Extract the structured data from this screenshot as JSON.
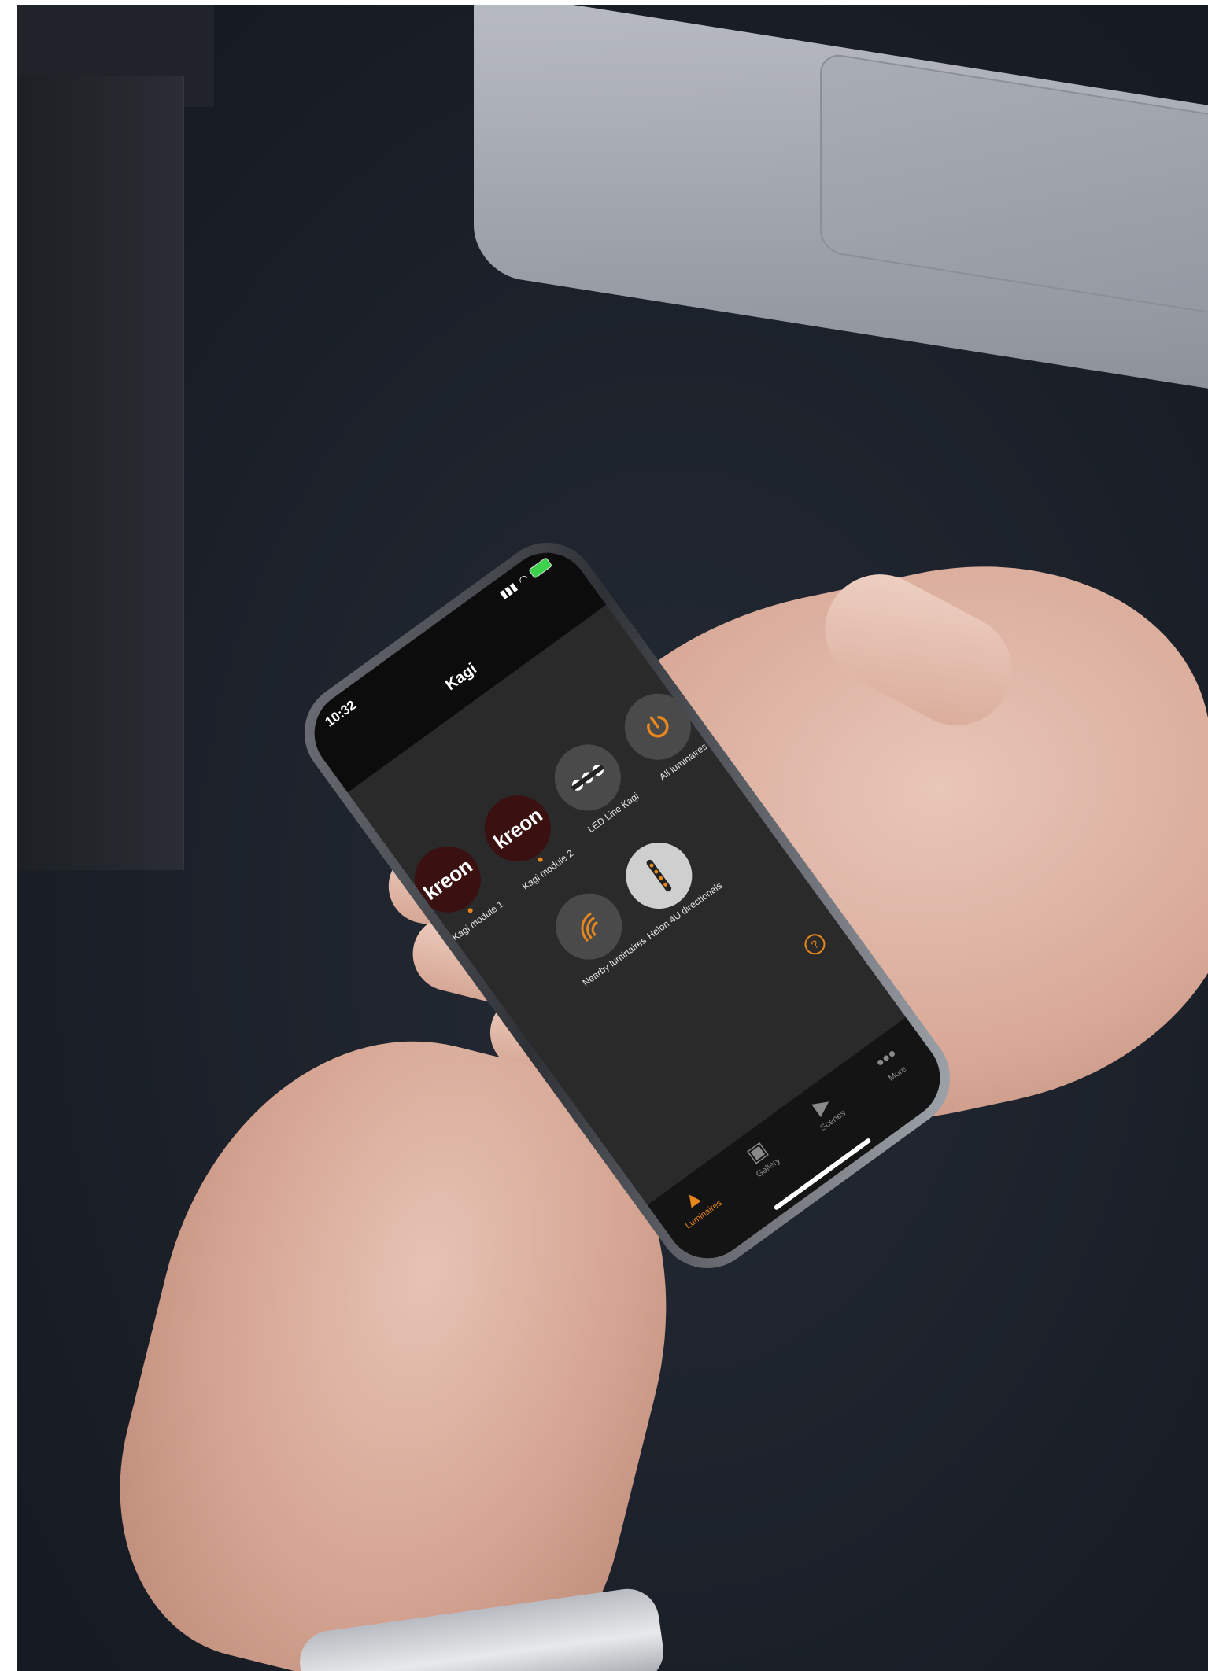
{
  "status": {
    "time": "10:32"
  },
  "nav": {
    "title": "Kagi"
  },
  "tiles_row1": [
    {
      "label": "Kagi module 1",
      "logo": "kreon"
    },
    {
      "label": "Kagi module 2",
      "logo": "kreon"
    },
    {
      "label": "LED Line Kagi",
      "icon": "led-line-icon"
    },
    {
      "label": "All luminaires",
      "icon": "power-icon"
    }
  ],
  "tiles_row2": [
    {
      "label": "Nearby luminaires",
      "icon": "nearby-icon"
    },
    {
      "label": "Helon 4U directionals",
      "icon": "helon-icon"
    }
  ],
  "help": {
    "glyph": "?"
  },
  "tabs": [
    {
      "label": "Luminaires",
      "icon": "lamp-icon",
      "active": true
    },
    {
      "label": "Gallery",
      "icon": "gallery-icon"
    },
    {
      "label": "Scenes",
      "icon": "scenes-icon"
    },
    {
      "label": "More",
      "icon": "more-icon"
    }
  ],
  "colors": {
    "accent": "#e8871c",
    "kreon_bg": "#3a1010",
    "screen_bg": "#2a2a2a"
  }
}
